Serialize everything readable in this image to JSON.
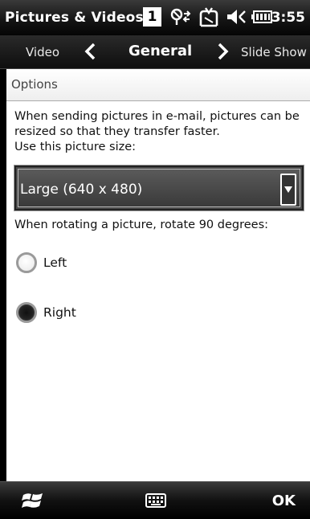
{
  "statusbar": {
    "title": "Pictures & Videos",
    "notification_count": "1",
    "time": "3:55",
    "icons": [
      "connectivity-icon",
      "missed-call-icon",
      "volume-icon",
      "battery-icon"
    ]
  },
  "tabs": {
    "prev": "Video",
    "active": "General",
    "next": "Slide Show"
  },
  "options": {
    "header": "Options",
    "description": "When sending pictures in e-mail, pictures can be resized so that they transfer faster.",
    "size_label": "Use this picture size:",
    "size_value": "Large (640 x 480)",
    "rotate_label": "When rotating a picture, rotate 90 degrees:",
    "radio_left": "Left",
    "radio_right": "Right",
    "selected_rotation": "Right"
  },
  "bottombar": {
    "ok_label": "OK",
    "start_icon": "windows-flag-icon",
    "keyboard_icon": "keyboard-icon"
  },
  "colors": {
    "panel_bg": "#ffffff",
    "bar_bg": "#111111",
    "dropdown_bg": "#4a4a4a"
  }
}
